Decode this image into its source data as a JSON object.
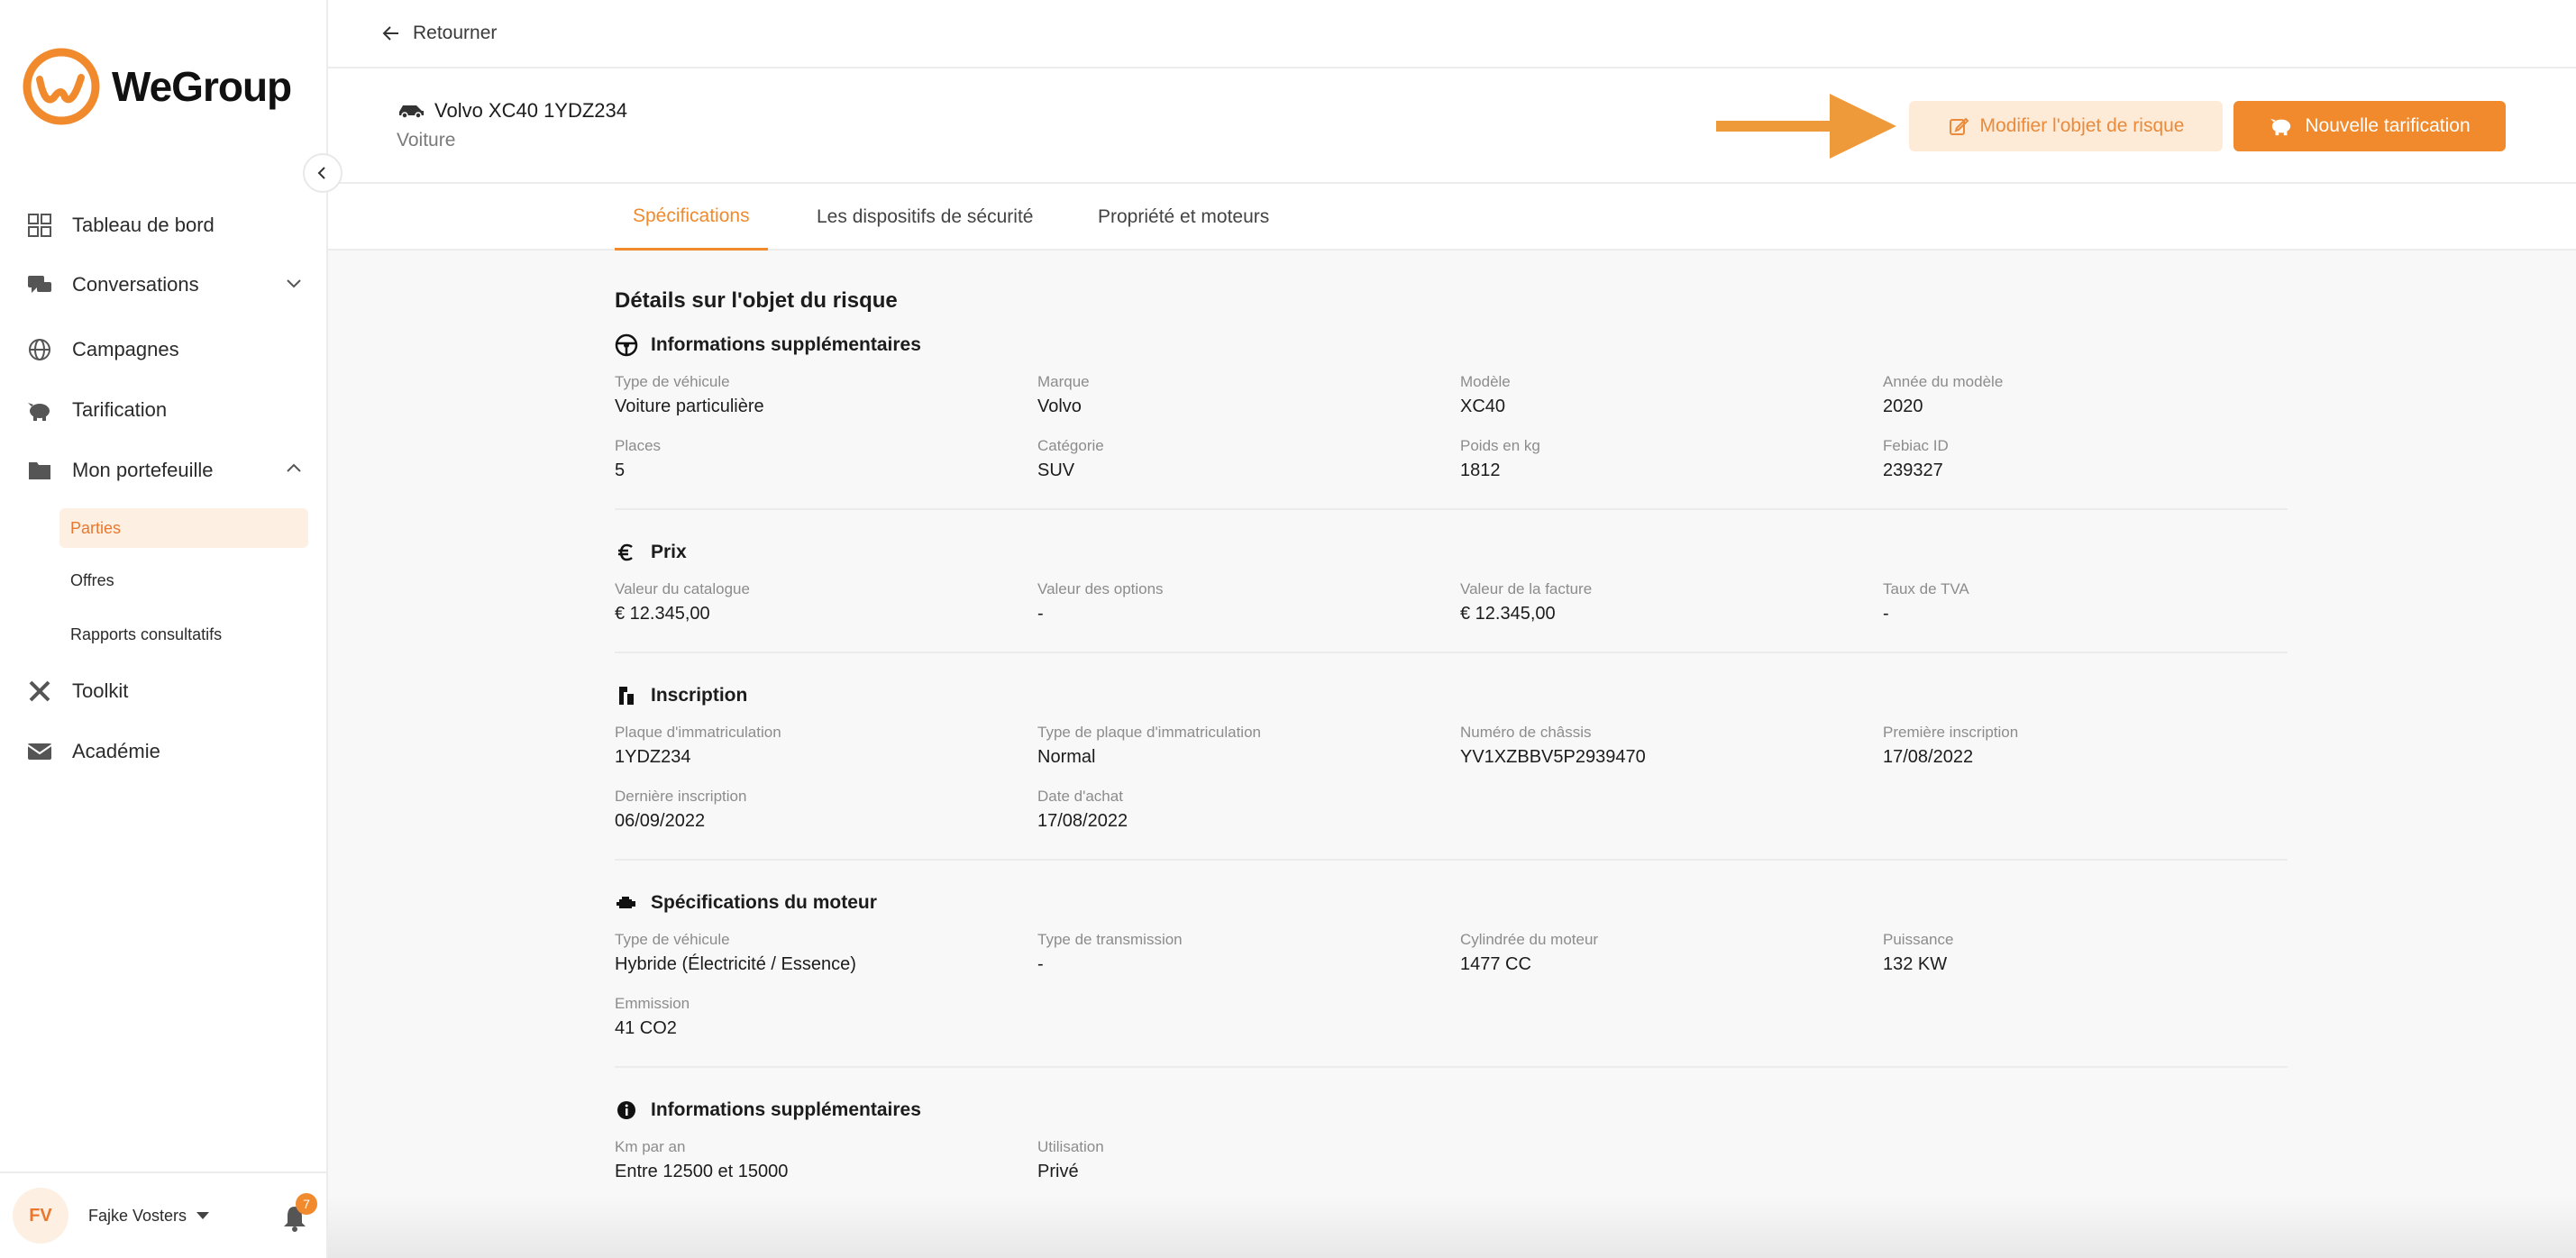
{
  "brand": {
    "name": "WeGroup",
    "accent": "#f08a2c"
  },
  "sidebar": {
    "items": [
      {
        "label": "Tableau de bord",
        "icon": "dashboard-icon"
      },
      {
        "label": "Conversations",
        "icon": "chat-icon"
      },
      {
        "label": "Campagnes",
        "icon": "globe-icon"
      },
      {
        "label": "Tarification",
        "icon": "piggy-bank-icon"
      },
      {
        "label": "Mon portefeuille",
        "icon": "folder-icon"
      },
      {
        "label": "Toolkit",
        "icon": "tools-icon"
      },
      {
        "label": "Académie",
        "icon": "mail-icon"
      }
    ],
    "subitems": [
      {
        "label": "Parties",
        "active": true
      },
      {
        "label": "Offres"
      },
      {
        "label": "Rapports consultatifs"
      }
    ]
  },
  "user": {
    "initials": "FV",
    "name": "Fajke Vosters",
    "notifications": "7"
  },
  "topbar": {
    "back_label": "Retourner"
  },
  "object": {
    "title": "Volvo XC40 1YDZ234",
    "subtitle": "Voiture"
  },
  "actions": {
    "edit_label": "Modifier l'objet de risque",
    "new_label": "Nouvelle tarification"
  },
  "tabs": [
    {
      "label": "Spécifications",
      "active": true
    },
    {
      "label": "Les dispositifs de sécurité"
    },
    {
      "label": "Propriété et moteurs"
    }
  ],
  "content": {
    "heading": "Détails sur l'objet du risque",
    "sections": [
      {
        "title": "Informations supplémentaires",
        "icon": "steering-wheel-icon",
        "fields": [
          {
            "label": "Type de véhicule",
            "value": "Voiture particulière"
          },
          {
            "label": "Marque",
            "value": "Volvo"
          },
          {
            "label": "Modèle",
            "value": "XC40"
          },
          {
            "label": "Année du modèle",
            "value": "2020"
          },
          {
            "label": "Places",
            "value": "5"
          },
          {
            "label": "Catégorie",
            "value": "SUV"
          },
          {
            "label": "Poids en kg",
            "value": "1812"
          },
          {
            "label": "Febiac ID",
            "value": "239327"
          }
        ]
      },
      {
        "title": "Prix",
        "icon": "euro-icon",
        "fields": [
          {
            "label": "Valeur du catalogue",
            "value": "€ 12.345,00"
          },
          {
            "label": "Valeur des options",
            "value": "-"
          },
          {
            "label": "Valeur de la facture",
            "value": "€ 12.345,00"
          },
          {
            "label": "Taux de TVA",
            "value": "-"
          }
        ]
      },
      {
        "title": "Inscription",
        "icon": "license-plate-icon",
        "fields": [
          {
            "label": "Plaque d'immatriculation",
            "value": "1YDZ234"
          },
          {
            "label": "Type de plaque d'immatriculation",
            "value": "Normal"
          },
          {
            "label": "Numéro de châssis",
            "value": "YV1XZBBV5P2939470"
          },
          {
            "label": "Première inscription",
            "value": "17/08/2022"
          },
          {
            "label": "Dernière inscription",
            "value": "06/09/2022"
          },
          {
            "label": "Date d'achat",
            "value": "17/08/2022"
          }
        ]
      },
      {
        "title": "Spécifications du moteur",
        "icon": "engine-icon",
        "fields": [
          {
            "label": "Type de véhicule",
            "value": "Hybride (Électricité / Essence)"
          },
          {
            "label": "Type de transmission",
            "value": "-"
          },
          {
            "label": "Cylindrée du moteur",
            "value": "1477 CC"
          },
          {
            "label": "Puissance",
            "value": "132 KW"
          },
          {
            "label": "Emmission",
            "value": "41 CO2"
          }
        ]
      },
      {
        "title": "Informations supplémentaires",
        "icon": "info-icon",
        "fields": [
          {
            "label": "Km par an",
            "value": "Entre 12500 et 15000"
          },
          {
            "label": "Utilisation",
            "value": "Privé"
          }
        ]
      }
    ]
  }
}
